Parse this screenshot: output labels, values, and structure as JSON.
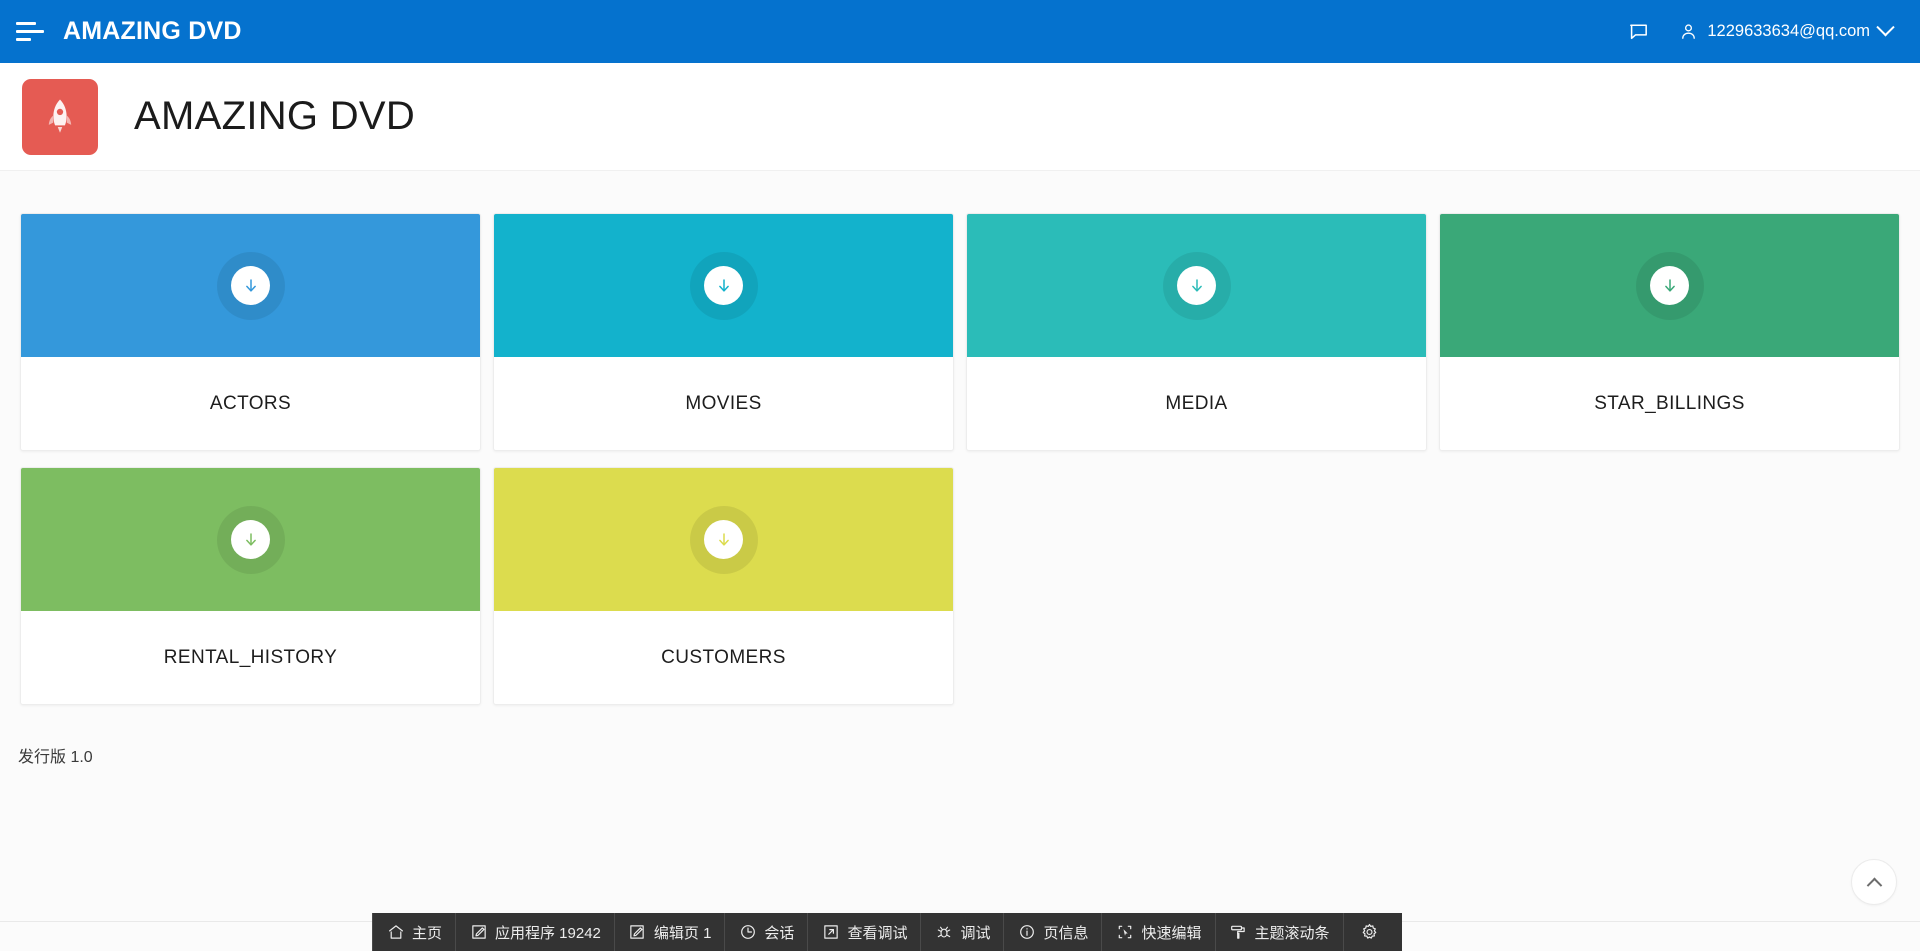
{
  "topbar": {
    "menu_icon": "hamburger-icon",
    "title": "AMAZING DVD",
    "comment_icon": "comment-icon",
    "user_icon": "user-icon",
    "user_email": "1229633634@qq.com",
    "chevron_icon": "chevron-down-icon",
    "background_color": "#0572ce"
  },
  "app_header": {
    "logo_icon": "rocket-icon",
    "logo_color": "#e55b53",
    "title": "AMAZING DVD"
  },
  "cards": [
    {
      "label": "ACTORS",
      "color": "#3498db",
      "icon": "download-icon"
    },
    {
      "label": "MOVIES",
      "color": "#13b2cc",
      "icon": "download-icon"
    },
    {
      "label": "MEDIA",
      "color": "#2bbcb8",
      "icon": "download-icon"
    },
    {
      "label": "STAR_BILLINGS",
      "color": "#3aa878",
      "icon": "download-icon"
    },
    {
      "label": "RENTAL_HISTORY",
      "color": "#7dbd61",
      "icon": "download-icon"
    },
    {
      "label": "CUSTOMERS",
      "color": "#dcdc4e",
      "icon": "download-icon"
    }
  ],
  "footer": {
    "version": "发行版 1.0",
    "scroll_top_icon": "chevron-up-icon"
  },
  "devbar": {
    "items": [
      {
        "label": "主页",
        "icon": "home-icon"
      },
      {
        "label": "应用程序 19242",
        "icon": "edit-square-icon"
      },
      {
        "label": "编辑页 1",
        "icon": "edit-square-icon"
      },
      {
        "label": "会话",
        "icon": "clock-icon"
      },
      {
        "label": "查看调试",
        "icon": "external-link-icon"
      },
      {
        "label": "调试",
        "icon": "bug-icon"
      },
      {
        "label": "页信息",
        "icon": "info-circle-icon"
      },
      {
        "label": "快速编辑",
        "icon": "cursor-select-icon"
      },
      {
        "label": "主题滚动条",
        "icon": "paint-roller-icon"
      },
      {
        "label": "",
        "icon": "gear-icon"
      }
    ],
    "background_color": "#333333"
  }
}
